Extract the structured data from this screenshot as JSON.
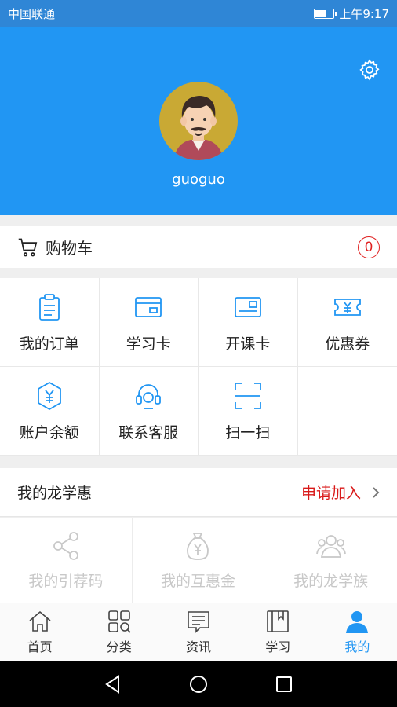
{
  "status_bar": {
    "carrier": "中国联通",
    "time": "上午9:17",
    "battery_level": 0.6
  },
  "profile": {
    "username": "guoguo"
  },
  "cart": {
    "label": "购物车",
    "count": "0"
  },
  "menu_grid": [
    {
      "label": "我的订单",
      "icon": "clipboard-icon"
    },
    {
      "label": "学习卡",
      "icon": "card-icon"
    },
    {
      "label": "开课卡",
      "icon": "id-card-icon"
    },
    {
      "label": "优惠券",
      "icon": "coupon-icon"
    },
    {
      "label": "账户余额",
      "icon": "balance-icon"
    },
    {
      "label": "联系客服",
      "icon": "headset-icon"
    },
    {
      "label": "扫一扫",
      "icon": "scan-icon"
    }
  ],
  "long_xue_hui": {
    "title": "我的龙学惠",
    "apply_label": "申请加入",
    "items": [
      {
        "label": "我的引荐码",
        "icon": "share-icon"
      },
      {
        "label": "我的互惠金",
        "icon": "money-bag-icon"
      },
      {
        "label": "我的龙学族",
        "icon": "group-icon"
      }
    ]
  },
  "tab_bar": [
    {
      "label": "首页",
      "icon": "home-icon",
      "active": false
    },
    {
      "label": "分类",
      "icon": "category-icon",
      "active": false
    },
    {
      "label": "资讯",
      "icon": "news-icon",
      "active": false
    },
    {
      "label": "学习",
      "icon": "book-icon",
      "active": false
    },
    {
      "label": "我的",
      "icon": "user-icon",
      "active": true
    }
  ],
  "colors": {
    "primary": "#2196f3",
    "status_bar": "#2f86d6",
    "accent_red": "#d91919",
    "disabled_text": "#c8c8c8"
  }
}
